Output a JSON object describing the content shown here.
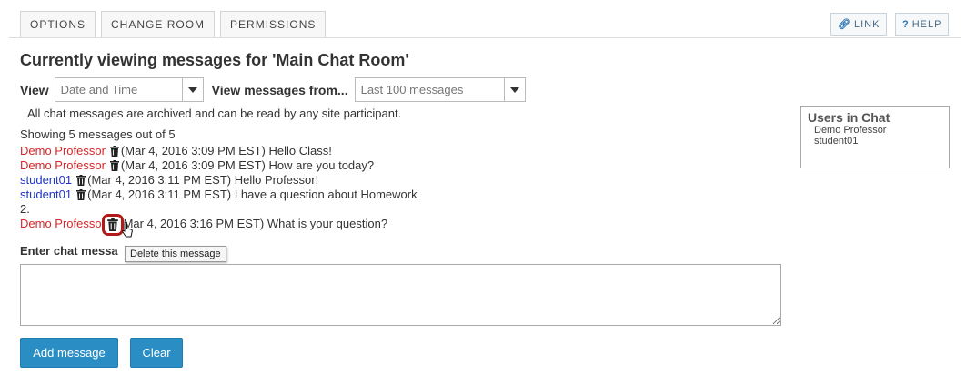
{
  "tabs": [
    "OPTIONS",
    "CHANGE ROOM",
    "PERMISSIONS"
  ],
  "header": {
    "link_label": "LINK",
    "help_label": "HELP"
  },
  "title": "Currently viewing messages for 'Main Chat Room'",
  "view": {
    "view_label": "View",
    "view_value": "Date and Time",
    "from_label": "View messages from...",
    "from_value": "Last 100 messages"
  },
  "archive_note": "All chat messages are archived and can be read by any site participant.",
  "showing": "Showing 5 messages out of 5",
  "messages": [
    {
      "author": "Demo Professor",
      "role": "professor",
      "text": "(Mar 4, 2016 3:09 PM EST) Hello Class!"
    },
    {
      "author": "Demo Professor",
      "role": "professor",
      "text": "(Mar 4, 2016 3:09 PM EST) How are you today?"
    },
    {
      "author": "student01",
      "role": "student",
      "text": "(Mar 4, 2016 3:11 PM EST) Hello Professor!"
    },
    {
      "author": "student01",
      "role": "student",
      "text": "(Mar 4, 2016 3:11 PM EST) I have a question about Homework 2."
    },
    {
      "author": "Demo Professo",
      "role": "professor",
      "text": "Mar 4, 2016 3:16 PM EST) What is your question?"
    }
  ],
  "tooltip": "Delete this message",
  "enter_label": "Enter chat messa",
  "buttons": {
    "add": "Add message",
    "clear": "Clear"
  },
  "users_panel": {
    "title": "Users in Chat",
    "users": [
      "Demo Professor",
      "student01"
    ]
  },
  "colors": {
    "professor": "#d8262a",
    "student": "#2034c8",
    "button": "#2a8dc4",
    "highlight": "#b21a1a"
  }
}
